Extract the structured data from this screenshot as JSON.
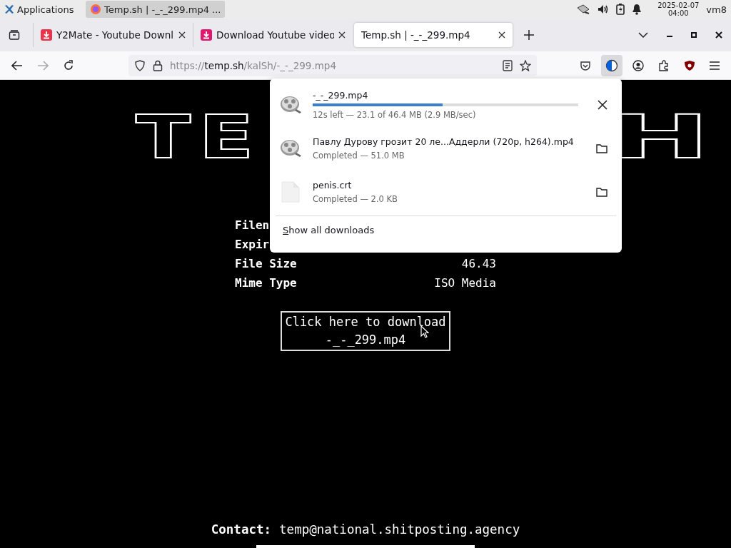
{
  "taskbar": {
    "applications": "Applications",
    "tasks": [
      {
        "title": "Temp.sh | -_-_299.mp4 ...",
        "selected": true
      }
    ],
    "date": "2025-02-07",
    "time": "04:00",
    "user": "vm8"
  },
  "tabs": [
    {
      "title": "Y2Mate - Youtube Downl",
      "selected": false,
      "color": "#e8334a"
    },
    {
      "title": "Download Youtube video",
      "selected": false,
      "color": "#e0176e"
    },
    {
      "title": "Temp.sh | -_-_299.mp4",
      "selected": true
    }
  ],
  "address_bar": {
    "scheme": "https://",
    "host": "temp.sh",
    "path": "/kalSh/-_-_299.mp4"
  },
  "page": {
    "logo_left": "TE",
    "logo_right": "H",
    "info": [
      {
        "label": "Filen"
      },
      {
        "label": "Expir"
      },
      {
        "label": "File Size",
        "value": "46.43"
      },
      {
        "label": "Mime Type",
        "value": "ISO Media"
      }
    ],
    "download_button": [
      "Click here to download",
      "-_-_299.mp4"
    ],
    "contact_label": "Contact:",
    "contact_email": "temp@national.shitposting.agency"
  },
  "downloads_panel": {
    "items": [
      {
        "kind": "video",
        "name": "-_-_299.mp4",
        "in_progress": true,
        "level": 0.49,
        "status": "12s left — 23.1 of 46.4 MB (2.9 MB/sec)"
      },
      {
        "kind": "video",
        "name": "Павлу Дурову грозит 20 ле...Аддерли (720p, h264).mp4",
        "in_progress": false,
        "status": "Completed — 51.0 MB"
      },
      {
        "kind": "file",
        "name": "penis.crt",
        "in_progress": false,
        "status": "Completed — 2.0 KB"
      }
    ],
    "show_all": "Show all downloads"
  }
}
